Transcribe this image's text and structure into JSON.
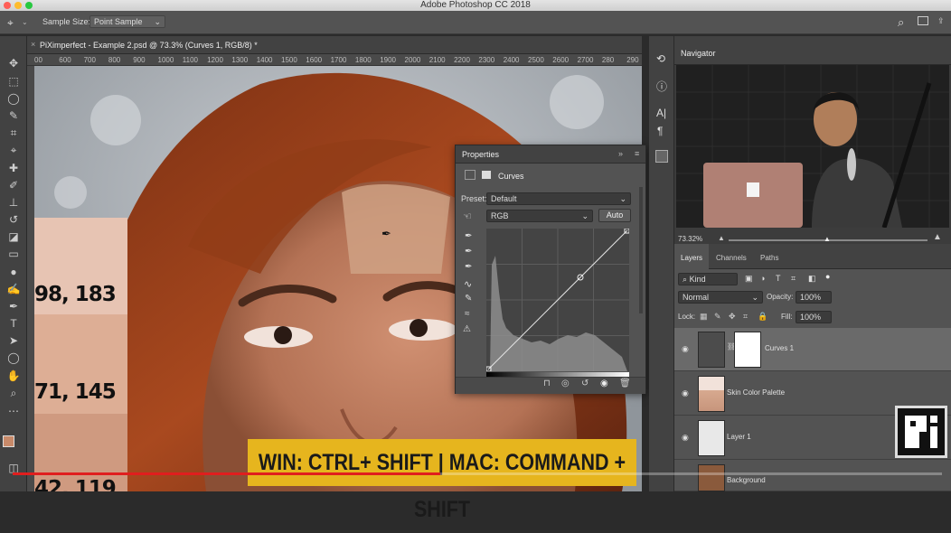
{
  "app": {
    "title": "Adobe Photoshop CC 2018"
  },
  "options_bar": {
    "sample_size_label": "Sample Size:",
    "sample_size_value": "Point Sample"
  },
  "document": {
    "tab_title": "PiXimperfect - Example 2.psd @ 73.3% (Curves 1, RGB/8) *"
  },
  "ruler": {
    "ticks": [
      "00",
      "600",
      "700",
      "800",
      "900",
      "1000",
      "1100",
      "1200",
      "1300",
      "1400",
      "1500",
      "1600",
      "1700",
      "1800",
      "1900",
      "2000",
      "2100",
      "2200",
      "2300",
      "2400",
      "2500",
      "2600",
      "2700",
      "280",
      "290"
    ]
  },
  "swatch_values": [
    "98, 183",
    "71, 145",
    "42, 119"
  ],
  "properties": {
    "title": "Properties",
    "panel_type": "Curves",
    "preset_label": "Preset:",
    "preset_value": "Default",
    "channel_value": "RGB",
    "auto_label": "Auto"
  },
  "navigator": {
    "title": "Navigator",
    "zoom": "73.32%"
  },
  "layers_panel": {
    "tabs": [
      "Layers",
      "Channels",
      "Paths"
    ],
    "kind_label": "Kind",
    "blend_mode": "Normal",
    "opacity_label": "Opacity:",
    "opacity_value": "100%",
    "lock_label": "Lock:",
    "fill_label": "Fill:",
    "fill_value": "100%",
    "layers": [
      "Curves 1",
      "Skin Color Palette",
      "Layer 1",
      "Background"
    ]
  },
  "banner": {
    "text": "WIN: CTRL+ SHIFT  |  MAC: COMMAND + SHIFT"
  },
  "colors": {
    "banner": "#e6b51e",
    "progress": "#e01e1e",
    "panel": "#535353"
  },
  "video": {
    "progress": 0.46
  }
}
